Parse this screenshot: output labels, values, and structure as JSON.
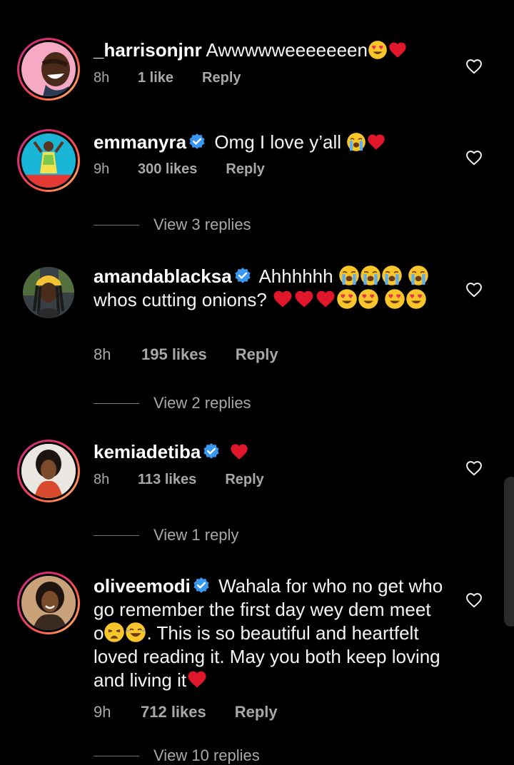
{
  "colors": {
    "background": "#000000",
    "text": "#f5f5f5",
    "secondary_text": "#a8a8a8",
    "verified_blue": "#3897f0",
    "heart_red": "#e0162b",
    "story_ring": "#e1306c"
  },
  "comments": [
    {
      "username": "_harrisonjnr",
      "verified": false,
      "text": "Awwwwweeeeeeen",
      "emojis": [
        "heart-eyes-emoji",
        "red-heart-emoji"
      ],
      "time": "8h",
      "likes": "1 like",
      "reply": "Reply",
      "like_icon": "heart-outline-icon"
    },
    {
      "username": "emmanyra",
      "verified": true,
      "text": "Omg I love y’all",
      "emojis": [
        "loudly-crying-emoji",
        "red-heart-emoji"
      ],
      "time": "9h",
      "likes": "300 likes",
      "reply": "Reply",
      "view_replies": "View 3 replies",
      "like_icon": "heart-outline-icon"
    },
    {
      "username": "amandablacksa",
      "verified": true,
      "text_part1": "Ahhhhhh",
      "text_part2": "whos cutting onions?",
      "emojis": [
        "loudly-crying-emoji",
        "red-heart-emoji",
        "heart-eyes-emoji"
      ],
      "time": "8h",
      "likes": "195 likes",
      "reply": "Reply",
      "view_replies": "View 2 replies",
      "like_icon": "heart-outline-icon"
    },
    {
      "username": "kemiadetiba",
      "verified": true,
      "text": "",
      "emojis": [
        "red-heart-emoji"
      ],
      "time": "8h",
      "likes": "113 likes",
      "reply": "Reply",
      "view_replies": "View 1 reply",
      "like_icon": "heart-outline-icon"
    },
    {
      "username": "oliveemodi",
      "verified": true,
      "text_part1": "Wahala for who no get who go remember the first day wey dem meet o",
      "text_part2": ". This is so beautiful and heartfelt  loved reading it. May you both keep loving and living it",
      "emojis": [
        "weary-emoji",
        "tears-of-joy-emoji",
        "red-heart-emoji"
      ],
      "time": "9h",
      "likes": "712 likes",
      "reply": "Reply",
      "view_replies": "View 10 replies",
      "like_icon": "heart-outline-icon"
    }
  ]
}
